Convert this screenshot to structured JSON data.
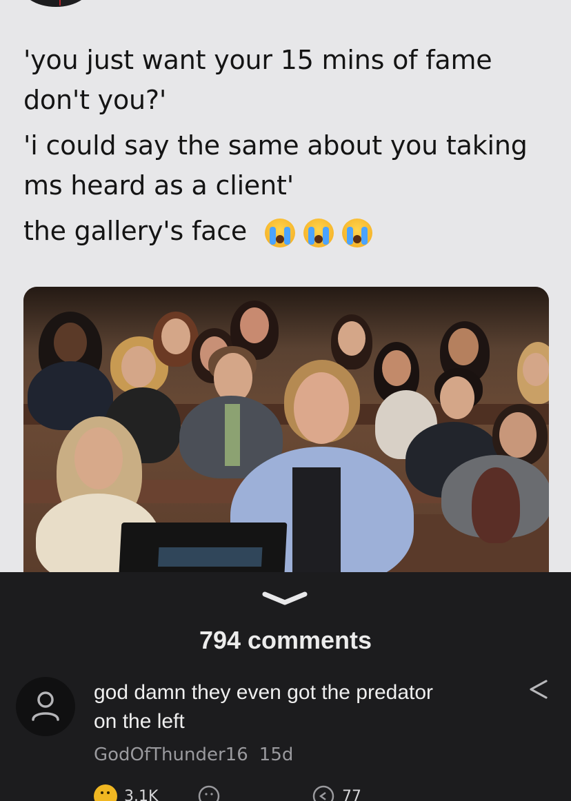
{
  "tweet": {
    "lines": [
      "'you just want your 15 mins of fame",
      "don't you?'",
      "'i could say the same about you taking",
      "ms heard as a client'",
      "the gallery's face"
    ],
    "emojis": [
      "loudly-crying-face",
      "loudly-crying-face",
      "loudly-crying-face"
    ]
  },
  "comments": {
    "count_label": "794 comments"
  },
  "comment": {
    "text_line1": "god damn they even got the predator",
    "text_line2": "on the left",
    "username": "GodOfThunder16",
    "age": "15d",
    "likes": "3.1K",
    "replies": "77"
  },
  "colors": {
    "tweet_bg": "#e7e7e9",
    "panel_bg": "#1c1c1e",
    "like_accent": "#f0b722"
  }
}
